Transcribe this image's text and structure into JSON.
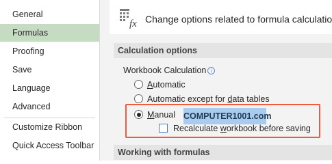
{
  "sidebar": {
    "items": [
      {
        "label": "General",
        "selected": false
      },
      {
        "label": "Formulas",
        "selected": true
      },
      {
        "label": "Proofing",
        "selected": false
      },
      {
        "label": "Save",
        "selected": false
      },
      {
        "label": "Language",
        "selected": false
      },
      {
        "label": "Advanced",
        "selected": false
      },
      {
        "label": "Customize Ribbon",
        "selected": false
      },
      {
        "label": "Quick Access Toolbar",
        "selected": false
      }
    ]
  },
  "header": {
    "icon": "formula-fx-icon",
    "text": "Change options related to formula calculation,"
  },
  "calculation_options": {
    "title": "Calculation options",
    "workbook_calculation_label": "Workbook Calculation",
    "options": [
      {
        "pre": "",
        "underline": "A",
        "post": "utomatic",
        "checked": false
      },
      {
        "pre": "Automatic except for ",
        "underline": "d",
        "post": "ata tables",
        "checked": false
      },
      {
        "pre": "",
        "underline": "M",
        "post": "anual",
        "checked": true
      }
    ],
    "recalc": {
      "pre": "Recalculate ",
      "underline": "w",
      "post": "orkbook before saving",
      "checked": false
    }
  },
  "watermark": "COMPUTER1001.com",
  "working_with_formulas": {
    "title": "Working with formulas"
  },
  "colors": {
    "selected_nav": "#c5dcc3",
    "highlight_border": "#f25a3a",
    "watermark_bg": "#a8cbee"
  }
}
